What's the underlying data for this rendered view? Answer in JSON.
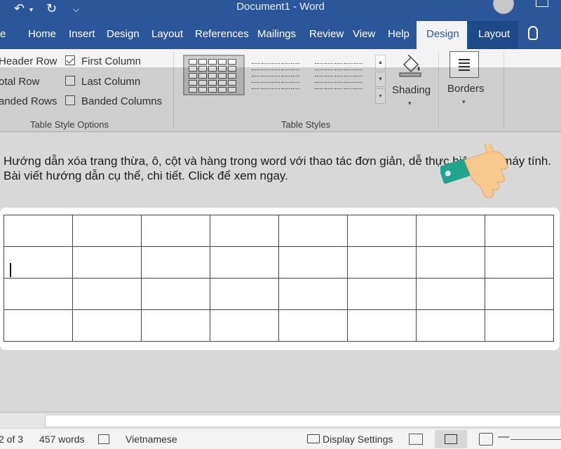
{
  "titlebar": {
    "quick_access": {
      "undo": "↶",
      "undo_caret": "▾",
      "redo": "↻",
      "customize": "⌵"
    },
    "title": "Document1  -  Word"
  },
  "ribbon_tabs": [
    {
      "label": "e"
    },
    {
      "label": "Home"
    },
    {
      "label": "Insert"
    },
    {
      "label": "Design"
    },
    {
      "label": "Layout"
    },
    {
      "label": "References"
    },
    {
      "label": "Mailings"
    },
    {
      "label": "Review"
    },
    {
      "label": "View"
    },
    {
      "label": "Help"
    },
    {
      "label": "Design",
      "active": true
    },
    {
      "label": "Layout",
      "context": true
    },
    {
      "label": "Tell me"
    }
  ],
  "table_style_options": {
    "group_label": "Table Style Options",
    "items": [
      {
        "label": "Header Row",
        "checked": true
      },
      {
        "label": "Total Row",
        "checked": false
      },
      {
        "label": "Banded Rows",
        "checked": true
      },
      {
        "label": "First Column",
        "checked": true
      },
      {
        "label": "Last Column",
        "checked": false
      },
      {
        "label": "Banded Columns",
        "checked": false
      }
    ],
    "visible_labels": [
      "Header Row",
      "otal Row",
      "anded Rows",
      "First Column",
      "Last Column",
      "Banded Columns"
    ]
  },
  "table_styles": {
    "group_label": "Table Styles"
  },
  "shading": {
    "label": "Shading",
    "icon": "paint-bucket-icon"
  },
  "borders": {
    "label": "Borders",
    "icon": "borders-icon"
  },
  "document": {
    "paragraph": "Hướng dẫn xóa trang thừa, ô, cột và hàng trong word với thao tác đơn giản, dễ thực hiện trên máy tính. Bài viết hướng dẫn cụ thể, chi tiết. Click để xem ngay.",
    "table": {
      "rows": 4,
      "cols": 8
    }
  },
  "statusbar": {
    "page": "2 of 3",
    "words": "457 words",
    "language": "Vietnamese",
    "display_settings": "Display Settings",
    "zoom_minus": "—"
  },
  "colors": {
    "accent": "#2b579a",
    "ribbon_bg": "#f3f3f3"
  }
}
